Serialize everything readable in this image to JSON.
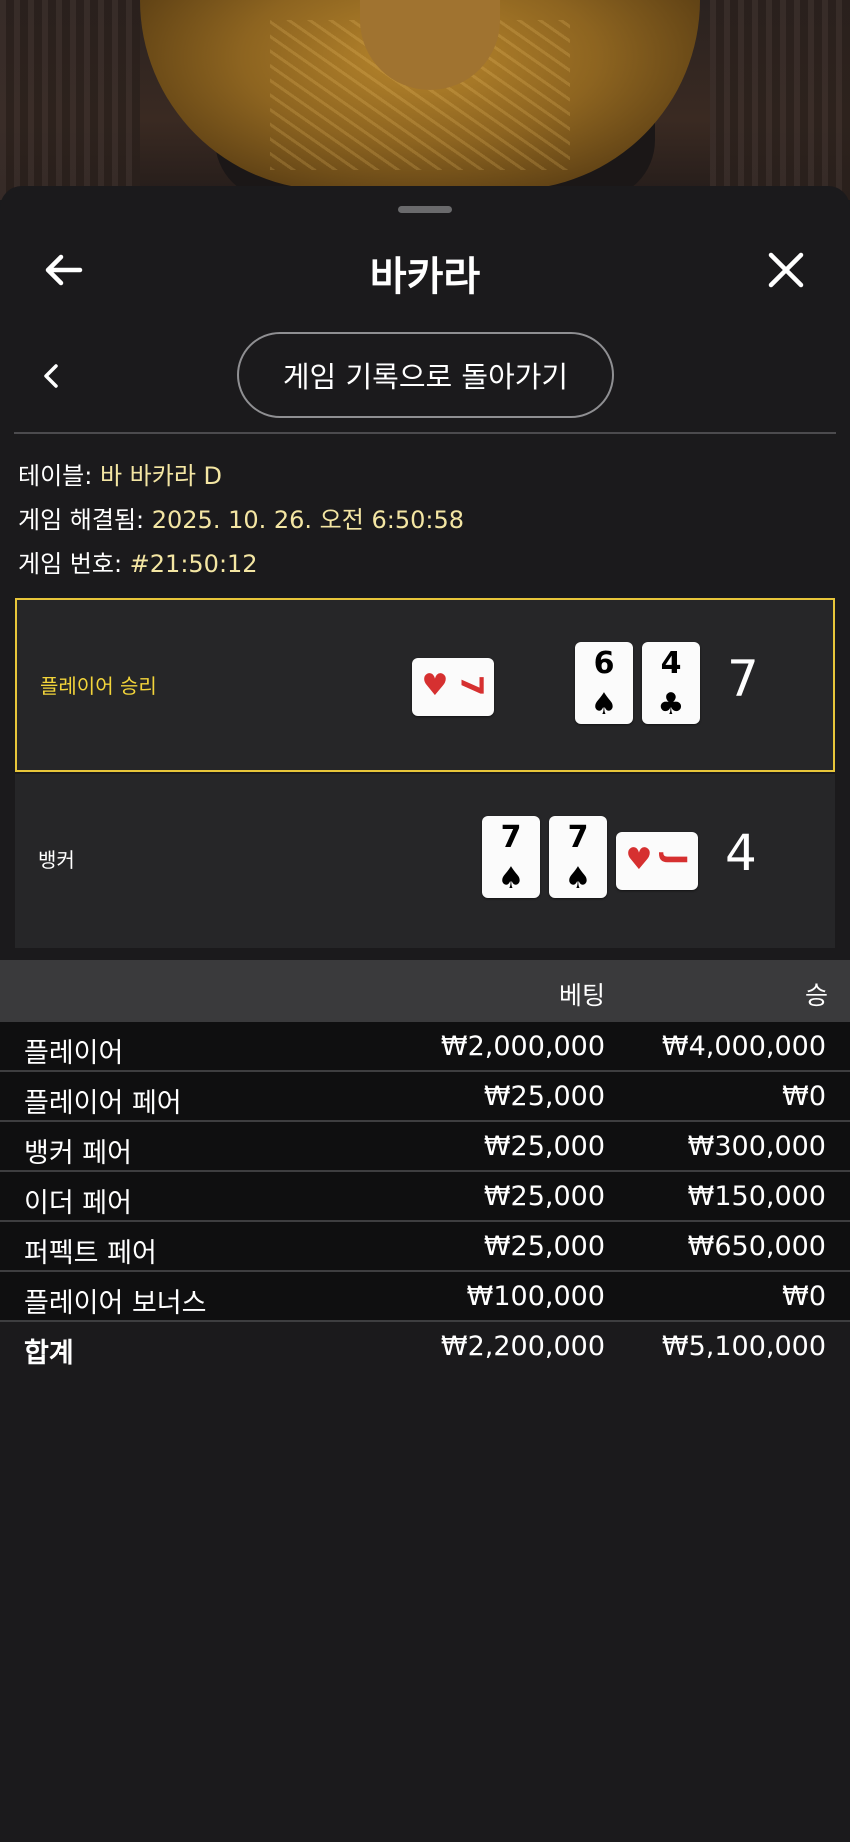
{
  "header": {
    "title": "바카라"
  },
  "subnav": {
    "history_button": "게임 기록으로 돌아가기"
  },
  "info": {
    "table_label": "테이블: ",
    "table_value": "바 바카라 D",
    "resolved_label": "게임 해결됨: ",
    "resolved_value": "2025. 10. 26. 오전 6:50:58",
    "number_label": "게임 번호: ",
    "number_value": "#21:50:12"
  },
  "hands": {
    "player": {
      "label": "플레이어 승리",
      "score": "7",
      "cards": [
        {
          "rank": "7",
          "suit": "♥",
          "color": "red",
          "orientation": "sideways"
        },
        {
          "rank": "6",
          "suit": "♠",
          "color": "black",
          "orientation": "upright"
        },
        {
          "rank": "4",
          "suit": "♣",
          "color": "black",
          "orientation": "upright"
        }
      ]
    },
    "banker": {
      "label": "뱅커",
      "score": "4",
      "cards": [
        {
          "rank": "7",
          "suit": "♠",
          "color": "black",
          "orientation": "upright"
        },
        {
          "rank": "7",
          "suit": "♠",
          "color": "black",
          "orientation": "upright"
        },
        {
          "rank": "J",
          "suit": "♥",
          "color": "red",
          "orientation": "sideways"
        }
      ]
    }
  },
  "table": {
    "headers": {
      "bet": "베팅",
      "win": "승"
    },
    "rows": [
      {
        "name": "플레이어",
        "bet": "₩2,000,000",
        "win": "₩4,000,000"
      },
      {
        "name": "플레이어 페어",
        "bet": "₩25,000",
        "win": "₩0"
      },
      {
        "name": "뱅커 페어",
        "bet": "₩25,000",
        "win": "₩300,000"
      },
      {
        "name": "이더 페어",
        "bet": "₩25,000",
        "win": "₩150,000"
      },
      {
        "name": "퍼펙트 페어",
        "bet": "₩25,000",
        "win": "₩650,000"
      },
      {
        "name": "플레이어 보너스",
        "bet": "₩100,000",
        "win": "₩0"
      }
    ],
    "total": {
      "name": "합계",
      "bet": "₩2,200,000",
      "win": "₩5,100,000"
    }
  },
  "colors": {
    "accent_gold": "#e8c63a",
    "value_text": "#f4e6a3",
    "card_red": "#d63030"
  },
  "icons": {
    "back": "arrow-left-icon",
    "close": "close-icon",
    "prev": "chevron-left-icon"
  }
}
